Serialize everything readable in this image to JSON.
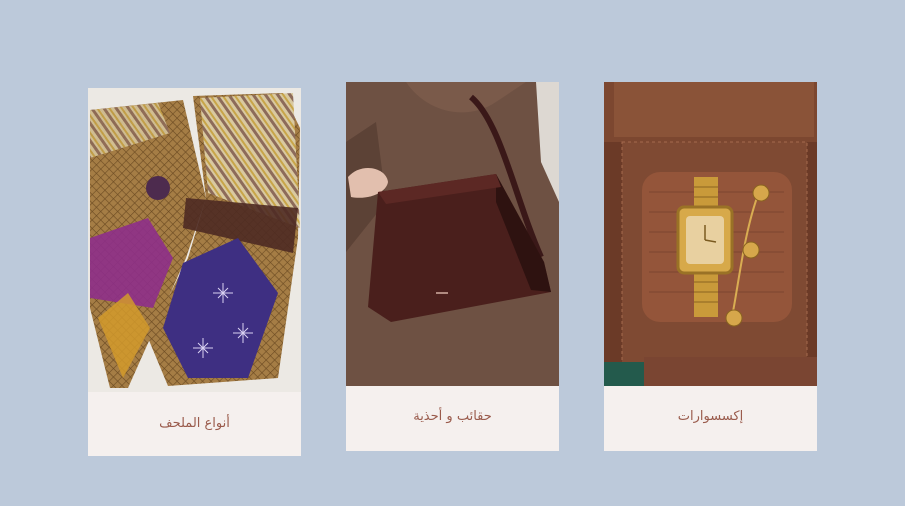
{
  "categories": [
    {
      "id": "fabrics",
      "label": "أنواع الملحف",
      "image": "colorful-patterned-fabric-image"
    },
    {
      "id": "bags-shoes",
      "label": "حقائب و أحذية",
      "image": "brown-leather-handbag-image"
    },
    {
      "id": "accessories",
      "label": "إكسسوارات",
      "image": "gold-watch-and-bracelet-image"
    }
  ],
  "colors": {
    "background": "#bcc9da",
    "card": "#f5f0ee",
    "caption_text": "#9a5b4c"
  }
}
